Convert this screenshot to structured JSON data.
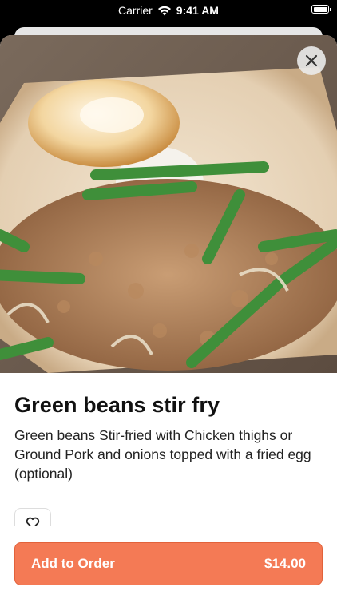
{
  "status_bar": {
    "carrier": "Carrier",
    "time": "9:41 AM",
    "wifi_icon": "wifi-icon",
    "battery_icon": "battery-icon"
  },
  "sheet": {
    "image_alt_icon": "food-photo",
    "close_icon": "close-icon"
  },
  "item": {
    "title": "Green beans stir fry",
    "description": "Green beans Stir-fried with Chicken thighs or Ground Pork and onions topped with a fried egg (optional)"
  },
  "favorite": {
    "icon": "heart-icon"
  },
  "order": {
    "label": "Add to Order",
    "price": "$14.00",
    "button_color": "#f47a55"
  }
}
